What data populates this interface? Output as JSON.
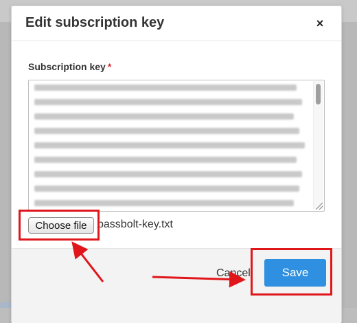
{
  "dialog": {
    "title": "Edit subscription key",
    "close_icon": "×"
  },
  "form": {
    "label": "Subscription key",
    "required_mark": "*",
    "file_button_label": "Choose file",
    "file_name": "passbolt-key.txt"
  },
  "footer": {
    "cancel_label": "Cancel",
    "save_label": "Save"
  },
  "colors": {
    "primary": "#2f8fe0",
    "annotation": "#e0161b",
    "required": "#d9262a"
  },
  "icons": {
    "close": "close-icon"
  }
}
